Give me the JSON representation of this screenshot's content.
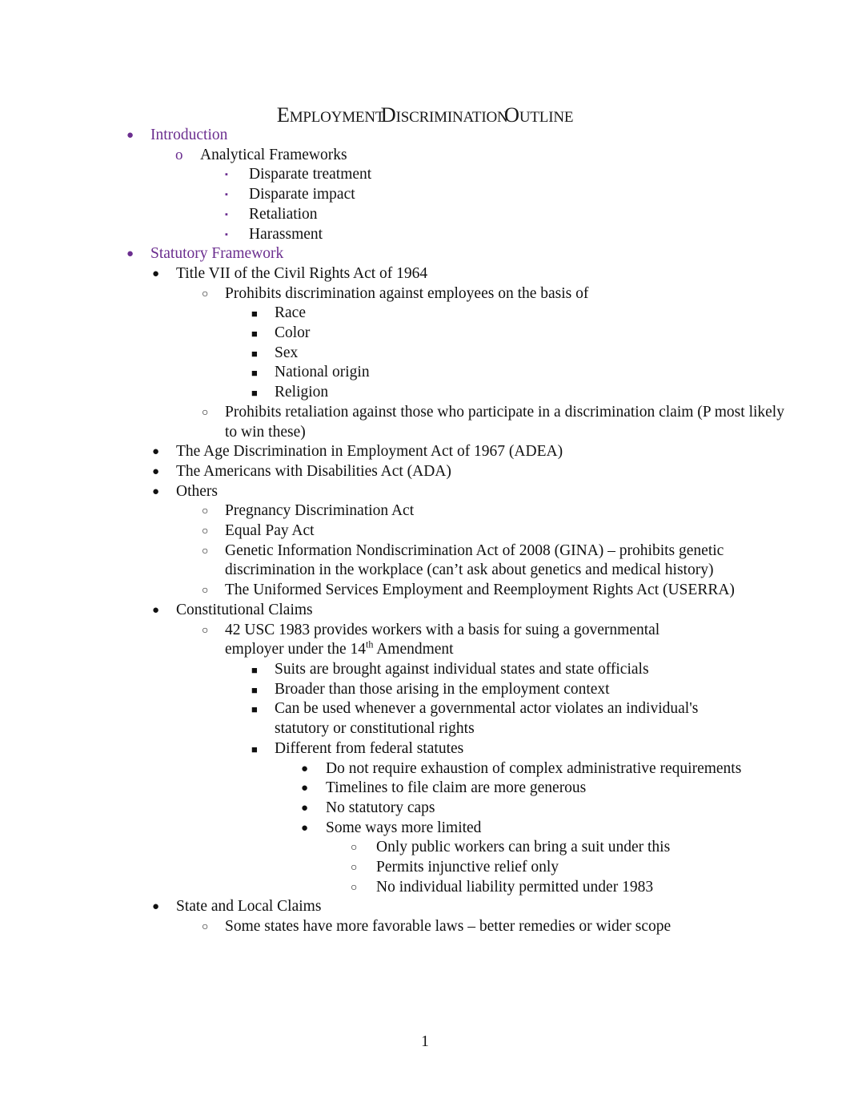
{
  "document": {
    "title": "Employment Discrimination Outline",
    "page_number": "1",
    "accent_color": "#6B2E8F",
    "text_color": "#111111"
  },
  "outline": {
    "introduction": {
      "heading": "Introduction",
      "analytical_frameworks": {
        "label": "Analytical Frameworks",
        "items": [
          "Disparate treatment",
          "Disparate impact",
          "Retaliation",
          "Harassment"
        ]
      }
    },
    "statutory_framework": {
      "heading": "Statutory Framework",
      "title_vii": {
        "label": "Title VII of the Civil Rights Act of 1964",
        "prohibits_discrimination": {
          "label": "Prohibits discrimination against employees on the basis of",
          "bases": [
            "Race",
            "Color",
            "Sex",
            "National origin",
            "Religion"
          ]
        },
        "prohibits_retaliation": "Prohibits retaliation against those who participate in a discrimination claim (P most likely to win these)"
      },
      "adea": "The Age Discrimination in Employment Act of 1967 (ADEA)",
      "ada": "The Americans with Disabilities Act (ADA)",
      "others": {
        "label": "Others",
        "items": [
          "Pregnancy Discrimination Act",
          "Equal Pay Act",
          "Genetic Information Nondiscrimination Act of 2008 (GINA) – prohibits genetic discrimination in the workplace (can’t ask about genetics and medical history)",
          "The Uniformed Services Employment and Reemployment Rights Act (USERRA)"
        ]
      },
      "constitutional_claims": {
        "label": "Constitutional Claims",
        "section_1983": {
          "label_before_sup": "42 USC 1983 provides workers with a basis for suing a governmental employer under the 14",
          "superscript": "th",
          "label_after_sup": " Amendment",
          "points": [
            "Suits are brought against individual states and state officials",
            "Broader than those arising in the employment context",
            "Can be used whenever a governmental actor violates an individual's statutory or constitutional rights"
          ],
          "different_from_federal_statutes": {
            "label": "Different from federal statutes",
            "items": [
              "Do not require exhaustion of complex administrative requirements",
              "Timelines to file claim are more generous",
              "No statutory caps"
            ],
            "some_ways_more_limited": {
              "label": "Some ways more limited",
              "items": [
                "Only public workers can bring a suit under this",
                "Permits injunctive relief only",
                "No individual liability permitted under 1983"
              ]
            }
          }
        }
      },
      "state_and_local_claims": {
        "label": "State and Local Claims",
        "detail": "Some states have more favorable laws – better remedies or wider scope"
      }
    }
  },
  "markers": {
    "disc": "●",
    "circle": "○",
    "square": "■",
    "small_square": "▪",
    "letter_o": "o"
  }
}
